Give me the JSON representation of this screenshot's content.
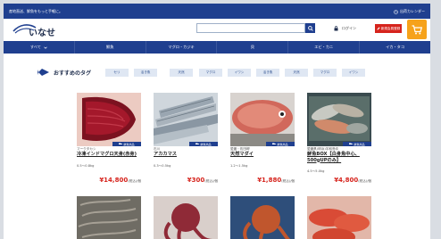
{
  "topbar": {
    "left_text": "産地直送、鮮魚をもっと手軽に。",
    "right_text": "出荷カレンダー"
  },
  "header": {
    "logo_text": "いなせり",
    "search_placeholder": "",
    "login_label": "ログイン",
    "signup_label": "新規会員登録"
  },
  "nav": {
    "items": [
      {
        "label": "すべて",
        "has_chevron": true
      },
      {
        "label": "鮮魚",
        "has_chevron": false
      },
      {
        "label": "マグロ・カジキ",
        "has_chevron": false
      },
      {
        "label": "貝",
        "has_chevron": false
      },
      {
        "label": "エビ・カニ",
        "has_chevron": false
      },
      {
        "label": "イカ・タコ",
        "has_chevron": false
      }
    ]
  },
  "tags": {
    "label": "おすすめのタグ",
    "items": [
      "セリ",
      "活き魚",
      "天然",
      "マグロ",
      "イワシ",
      "活き魚",
      "天然",
      "マグロ",
      "イワシ"
    ]
  },
  "products": [
    {
      "origin": "マークタカシ",
      "name": "冷凍インドマグロ天身(赤身)",
      "weight": "0.5～0.8kg",
      "price": "¥14,800",
      "tax": "(税込)/個",
      "badge": "鮮魚商品"
    },
    {
      "origin": "石川",
      "name": "アカカマス",
      "weight": "0.3～0.5kg",
      "price": "¥300",
      "tax": "(税込)/個",
      "badge": "鮮魚商品"
    },
    {
      "origin": "愛媛・佐田岬",
      "name": "天然マダイ",
      "weight": "1.2～1.5kg",
      "price": "¥1,880",
      "tax": "(税込)/個",
      "badge": "鮮魚商品"
    },
    {
      "origin": "愛媛県(明浜)宇和島沖",
      "name": "鮮魚BOX【白身魚中心、500gUPのみ】",
      "weight": "4.5～5.0kg",
      "price": "¥4,800",
      "tax": "(税込)/個",
      "badge": "鮮魚商品"
    }
  ],
  "colors": {
    "brand_navy": "#1f3f8f",
    "accent_red": "#d6241d",
    "cart_orange": "#f6a21b",
    "tag_bg": "#dfe7f3"
  }
}
